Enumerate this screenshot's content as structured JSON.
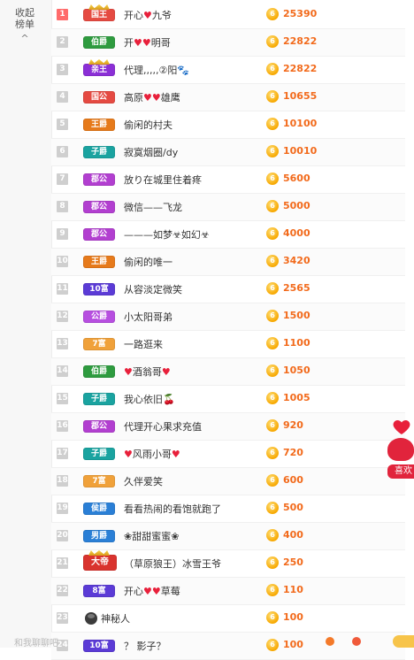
{
  "side": {
    "collapse_line1": "收起",
    "collapse_line2": "榜单",
    "chevron": "^"
  },
  "rows": [
    {
      "rank": "1",
      "badge": "国王",
      "name_pre": "开心",
      "heart1": "♥",
      "name_post": "九爷",
      "score": "25390",
      "badge_color": "#e54a42"
    },
    {
      "rank": "2",
      "badge": "伯爵",
      "name_pre": "开",
      "heart1": "♥",
      "heart2": "♥",
      "name_post": "明哥",
      "score": "22822",
      "badge_color": "#2e9b3f"
    },
    {
      "rank": "3",
      "badge": "亲王",
      "name_pre": "代理,,,,,②阳",
      "extra": "🐾",
      "score": "22822",
      "badge_color": "#8b2fd6"
    },
    {
      "rank": "4",
      "badge": "国公",
      "name_pre": "高原",
      "heart1": "♥",
      "heart2": "♥",
      "name_post": "雄鹰",
      "score": "10655",
      "badge_color": "#e54a42"
    },
    {
      "rank": "5",
      "badge": "王爵",
      "name_pre": "偷闲的村夫",
      "score": "10100",
      "badge_color": "#e67a1b"
    },
    {
      "rank": "6",
      "badge": "子爵",
      "name_pre": "寂寞烟圈/dy",
      "score": "10010",
      "badge_color": "#1aa3a0"
    },
    {
      "rank": "7",
      "badge": "郡公",
      "name_pre": "放り在城里住着疼",
      "score": "5600",
      "badge_color": "#b23fd0"
    },
    {
      "rank": "8",
      "badge": "郡公",
      "name_pre": "微信——飞龙",
      "score": "5000",
      "badge_color": "#b23fd0"
    },
    {
      "rank": "9",
      "badge": "郡公",
      "name_pre": "———如梦☣如幻☣",
      "score": "4000",
      "badge_color": "#b23fd0"
    },
    {
      "rank": "10",
      "badge": "王爵",
      "name_pre": "偷闲的唯一",
      "score": "3420",
      "badge_color": "#e67a1b"
    },
    {
      "rank": "11",
      "badge": "10富",
      "name_pre": "从容淡定微笑",
      "score": "2565",
      "badge_color": "#5b3bd6"
    },
    {
      "rank": "12",
      "badge": "公爵",
      "name_pre": "小太阳哥弟",
      "score": "1500",
      "badge_color": "#b74fe0"
    },
    {
      "rank": "13",
      "badge": "7富",
      "name_pre": "一路逛来",
      "score": "1100",
      "badge_color": "#f0a13a"
    },
    {
      "rank": "14",
      "badge": "伯爵",
      "heart1": "♥",
      "name_pre": "",
      "name_post": "酒翁哥",
      "heart2": "♥",
      "score": "1050",
      "badge_color": "#2e9b3f"
    },
    {
      "rank": "15",
      "badge": "子爵",
      "name_pre": "我心依旧",
      "extra": "🍒",
      "score": "1005",
      "badge_color": "#1aa3a0"
    },
    {
      "rank": "16",
      "badge": "郡公",
      "name_pre": "代理开心果求充值",
      "score": "920",
      "badge_color": "#b23fd0"
    },
    {
      "rank": "17",
      "badge": "子爵",
      "heart1": "♥",
      "name_pre": "",
      "name_post": "风雨小哥",
      "heart2": "♥",
      "score": "720",
      "badge_color": "#1aa3a0"
    },
    {
      "rank": "18",
      "badge": "7富",
      "name_pre": "久伴爱笑",
      "score": "600",
      "badge_color": "#f0a13a"
    },
    {
      "rank": "19",
      "badge": "侯爵",
      "name_pre": "看看热闹的看饱就跑了",
      "score": "500",
      "badge_color": "#2a7fd6"
    },
    {
      "rank": "20",
      "badge": "男爵",
      "name_pre": "❀甜甜蜜蜜❀",
      "score": "400",
      "badge_color": "#2a7fd6"
    },
    {
      "rank": "21",
      "badge": "大帝",
      "name_pre": "（草原狼王）冰雪王爷",
      "score": "250",
      "badge_color": "#d9332e"
    },
    {
      "rank": "22",
      "badge": "8富",
      "name_pre": "开心",
      "heart1": "♥",
      "heart2": "♥",
      "name_post": "草莓",
      "score": "110",
      "badge_color": "#5b3bd6"
    },
    {
      "rank": "23",
      "badge": "",
      "name_pre": "神秘人",
      "score": "100",
      "badge_color": ""
    },
    {
      "rank": "24",
      "badge": "10富",
      "name_pre": "？ 影子？",
      "score": "100",
      "badge_color": "#5b3bd6"
    }
  ],
  "coin_symbol": "6",
  "floatad": {
    "text": "喜欢"
  },
  "bottom": {
    "text": "和我聊聊吧"
  }
}
